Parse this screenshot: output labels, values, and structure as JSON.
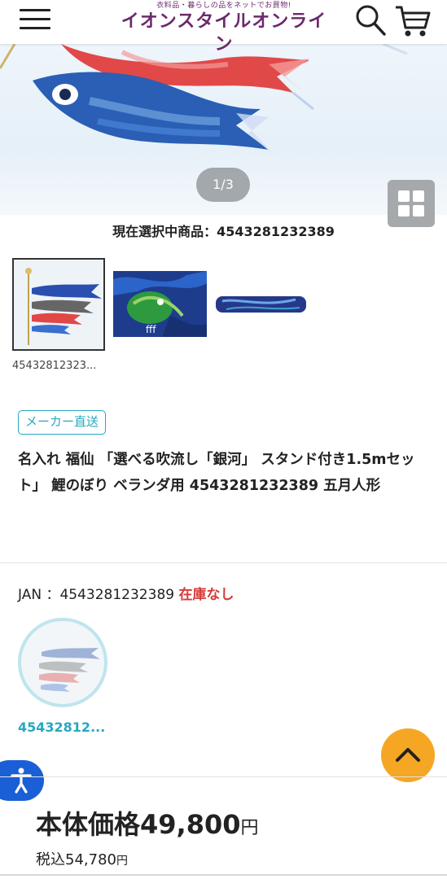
{
  "header": {
    "tagline": "衣料品・暮らしの品をネットでお買物!",
    "brand": "イオンスタイルオンライン",
    "brand_color": "#6b2a6b",
    "menu_icon": "hamburger-icon",
    "search_icon": "search-icon",
    "cart_icon": "cart-icon"
  },
  "gallery": {
    "slide_indicator": "1/3",
    "current_selection": "現在選択中商品：4543281232389",
    "thumb_caption": "45432812323...",
    "grid_icon": "grid-icon"
  },
  "product": {
    "badge": "メーカー直送",
    "title": "名入れ 福仙 「選べる吹流し「銀河」 スタンド付き1.5mセット」 鯉のぼり ベランダ用 4543281232389 五月人形",
    "jan_label": "JAN ：4543281232389",
    "stock_status": "在庫なし",
    "variant_label": "45432812..."
  },
  "price": {
    "label": "本体価格49,800",
    "yen": "円",
    "tax_label": "税込54,780",
    "tax_yen": "円"
  },
  "colors": {
    "accent": "#27a8c0",
    "stock_red": "#d43b3b",
    "to_top": "#f5a623",
    "a11y": "#1a5fd6"
  }
}
